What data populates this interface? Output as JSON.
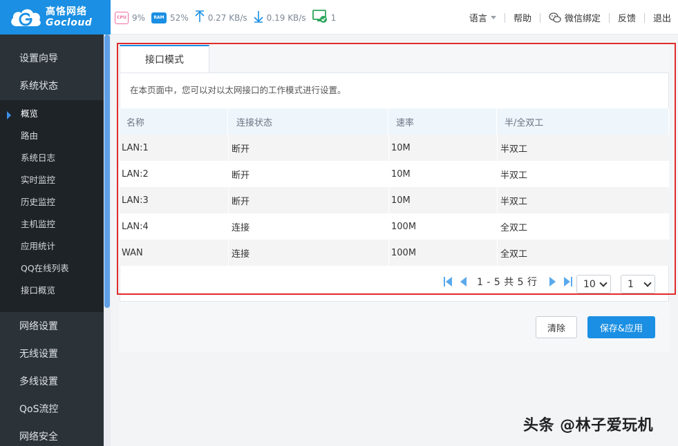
{
  "brand": {
    "name_cn": "高恪网络",
    "name_en": "Gocloud"
  },
  "status": {
    "cpu_label": "CPU",
    "cpu": "9%",
    "ram_label": "RAM",
    "ram": "52%",
    "upload": "0.27 KB/s",
    "download": "0.19 KB/s",
    "online_devices": "1"
  },
  "topnav": {
    "language": "语言",
    "help": "帮助",
    "wechat": "微信绑定",
    "feedback": "反馈",
    "logout": "退出"
  },
  "sidebar": {
    "sections": [
      "设置向导",
      "系统状态"
    ],
    "sub_items": [
      "概览",
      "路由",
      "系统日志",
      "实时监控",
      "历史监控",
      "主机监控",
      "应用统计",
      "QQ在线列表",
      "接口概览"
    ],
    "active_sub": "概览",
    "lower_sections": [
      "网络设置",
      "无线设置",
      "多线设置",
      "QoS流控",
      "网络安全"
    ]
  },
  "page": {
    "tab_label": "接口模式",
    "description": "在本页面中，您可以对以太网接口的工作模式进行设置。"
  },
  "table": {
    "headers": [
      "名称",
      "连接状态",
      "速率",
      "半/全双工"
    ],
    "rows": [
      [
        "LAN:1",
        "断开",
        "10M",
        "半双工"
      ],
      [
        "LAN:2",
        "断开",
        "10M",
        "半双工"
      ],
      [
        "LAN:3",
        "断开",
        "10M",
        "半双工"
      ],
      [
        "LAN:4",
        "连接",
        "100M",
        "全双工"
      ],
      [
        "WAN",
        "连接",
        "100M",
        "全双工"
      ]
    ]
  },
  "pagination": {
    "info": "1 - 5 共 5 行",
    "page_size": "10",
    "page": "1"
  },
  "buttons": {
    "clear": "清除",
    "save": "保存&应用"
  },
  "watermark": "头条 @林子爱玩机",
  "colors": {
    "accent": "#1a8fe3",
    "sidebar_bg": "#2b3238",
    "highlight": "#e02a2a"
  }
}
